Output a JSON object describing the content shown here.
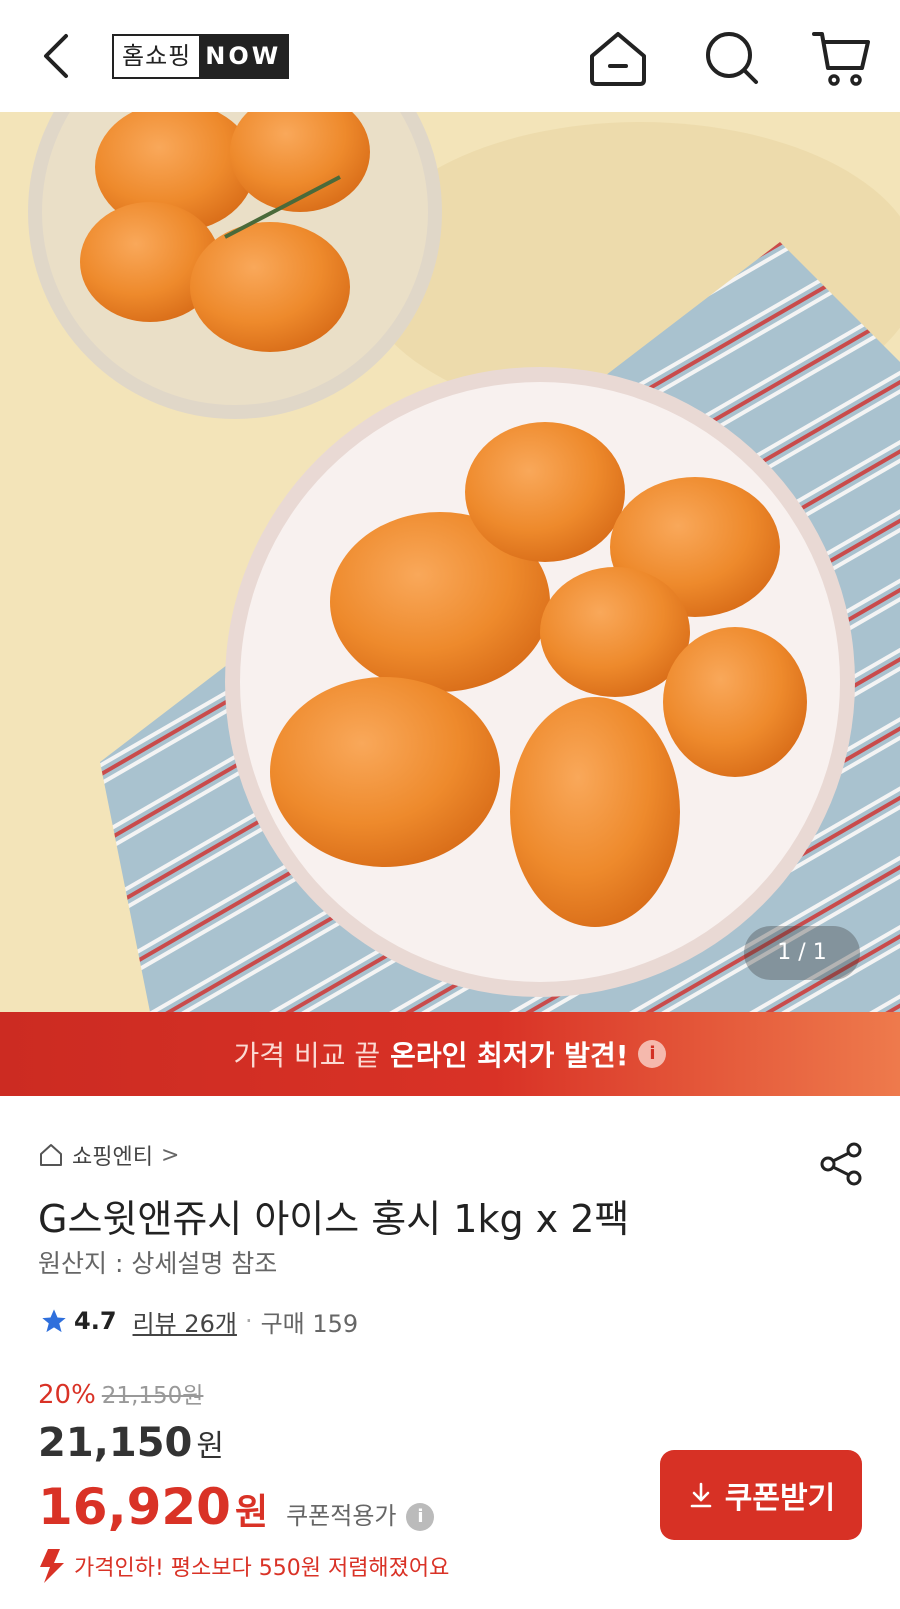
{
  "header": {
    "logo_kr": "홈쇼핑",
    "logo_en": "NOW",
    "icons": [
      "back-icon",
      "home-icon",
      "search-icon",
      "cart-icon"
    ]
  },
  "hero": {
    "counter": "1 / 1"
  },
  "banner": {
    "text_light": "가격 비교 끝",
    "text_bold": "온라인 최저가 발견!",
    "info": "i"
  },
  "product": {
    "breadcrumb": "쇼핑엔티",
    "breadcrumb_chevron": ">",
    "title": "G스윗앤쥬시 아이스 홍시 1kg x 2팩",
    "origin": "원산지 : 상세설명 참조",
    "rating": "4.7",
    "reviews": "리뷰 26개",
    "purchases": "구매 159",
    "separator": "·"
  },
  "pricing": {
    "discount_pct": "20%",
    "original_price": "21,150원",
    "price_amount": "21,150",
    "price_unit": "원",
    "coupon_amount": "16,920",
    "coupon_unit": "원",
    "coupon_label": "쿠폰적용가",
    "coupon_info": "i",
    "coupon_button": "쿠폰받기",
    "price_drop_note": "가격인하! 평소보다 550원 저렴해졌어요"
  },
  "colors": {
    "accent": "#d93226",
    "banner_end": "#ee7a4c",
    "star": "#2f6fdc"
  }
}
